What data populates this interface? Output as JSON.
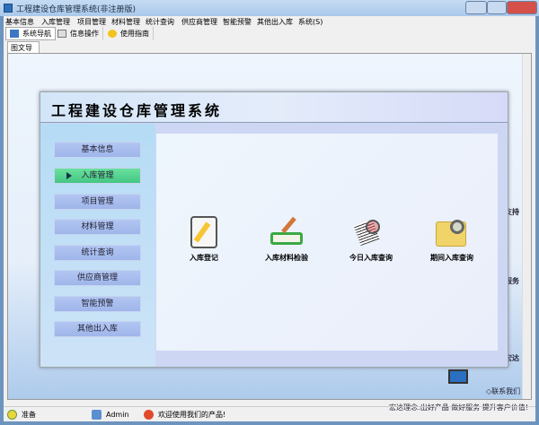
{
  "window": {
    "title": "工程建设仓库管理系统(非注册版)"
  },
  "menu": [
    "基本信息",
    "入库管理",
    "项目管理",
    "材料管理",
    "统计查询",
    "供应商管理",
    "智能预警",
    "其他出入库",
    "系统(S)"
  ],
  "toolbar": [
    {
      "label": "系统导航",
      "icon": "navigation-icon"
    },
    {
      "label": "信息操作",
      "icon": "info-icon"
    },
    {
      "label": "使用指南",
      "icon": "help-icon"
    }
  ],
  "tab": "图文导航",
  "panel": {
    "title": "工程建设仓库管理系统",
    "sidebar": [
      "基本信息",
      "入库管理",
      "项目管理",
      "材料管理",
      "统计查询",
      "供应商管理",
      "智能预警",
      "其他出入库"
    ],
    "active": "入库管理",
    "functions": [
      {
        "label": "入库登记",
        "icon": "register-icon"
      },
      {
        "label": "入库材料检验",
        "icon": "inspection-book-icon"
      },
      {
        "label": "今日入库查询",
        "icon": "today-query-icon"
      },
      {
        "label": "期间入库查询",
        "icon": "folder-search-icon"
      }
    ]
  },
  "background": {
    "support": "支持",
    "service": "服务",
    "brand": "宏达",
    "contact": "◇联系我们",
    "slogan": "宏达理念:出好产品 做好服务 提升客户价值!"
  },
  "status": {
    "state": "准备",
    "user": "Admin",
    "message": "欢迎使用我们的产品!"
  }
}
